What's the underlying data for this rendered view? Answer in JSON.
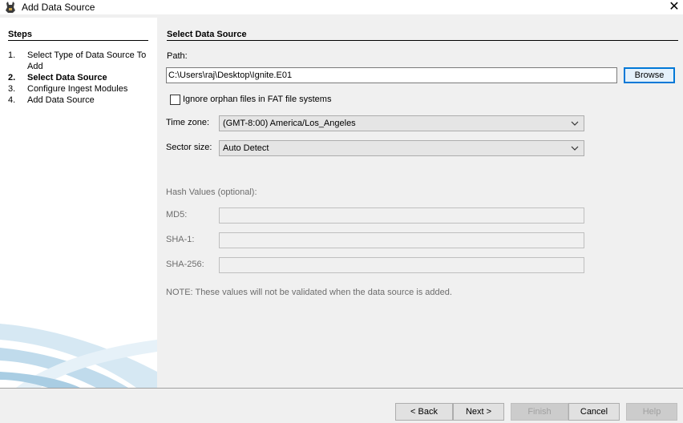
{
  "window": {
    "title": "Add Data Source",
    "close_symbol": "✕"
  },
  "steps": {
    "title": "Steps",
    "items": [
      {
        "num": "1.",
        "label": "Select Type of Data Source To Add"
      },
      {
        "num": "2.",
        "label": "Select Data Source"
      },
      {
        "num": "3.",
        "label": "Configure Ingest Modules"
      },
      {
        "num": "4.",
        "label": "Add Data Source"
      }
    ]
  },
  "main": {
    "title": "Select Data Source",
    "path_label": "Path:",
    "path_value": "C:\\Users\\raj\\Desktop\\Ignite.E01",
    "browse_label": "Browse",
    "orphan_label": "Ignore orphan files in FAT file systems",
    "timezone_label": "Time zone:",
    "timezone_value": "(GMT-8:00) America/Los_Angeles",
    "sector_label": "Sector size:",
    "sector_value": "Auto Detect",
    "hash_title": "Hash Values (optional):",
    "md5_label": "MD5:",
    "sha1_label": "SHA-1:",
    "sha256_label": "SHA-256:",
    "note": "NOTE: These values will not be validated when the data source is added."
  },
  "footer": {
    "back": "< Back",
    "next": "Next >",
    "finish": "Finish",
    "cancel": "Cancel",
    "help": "Help"
  }
}
